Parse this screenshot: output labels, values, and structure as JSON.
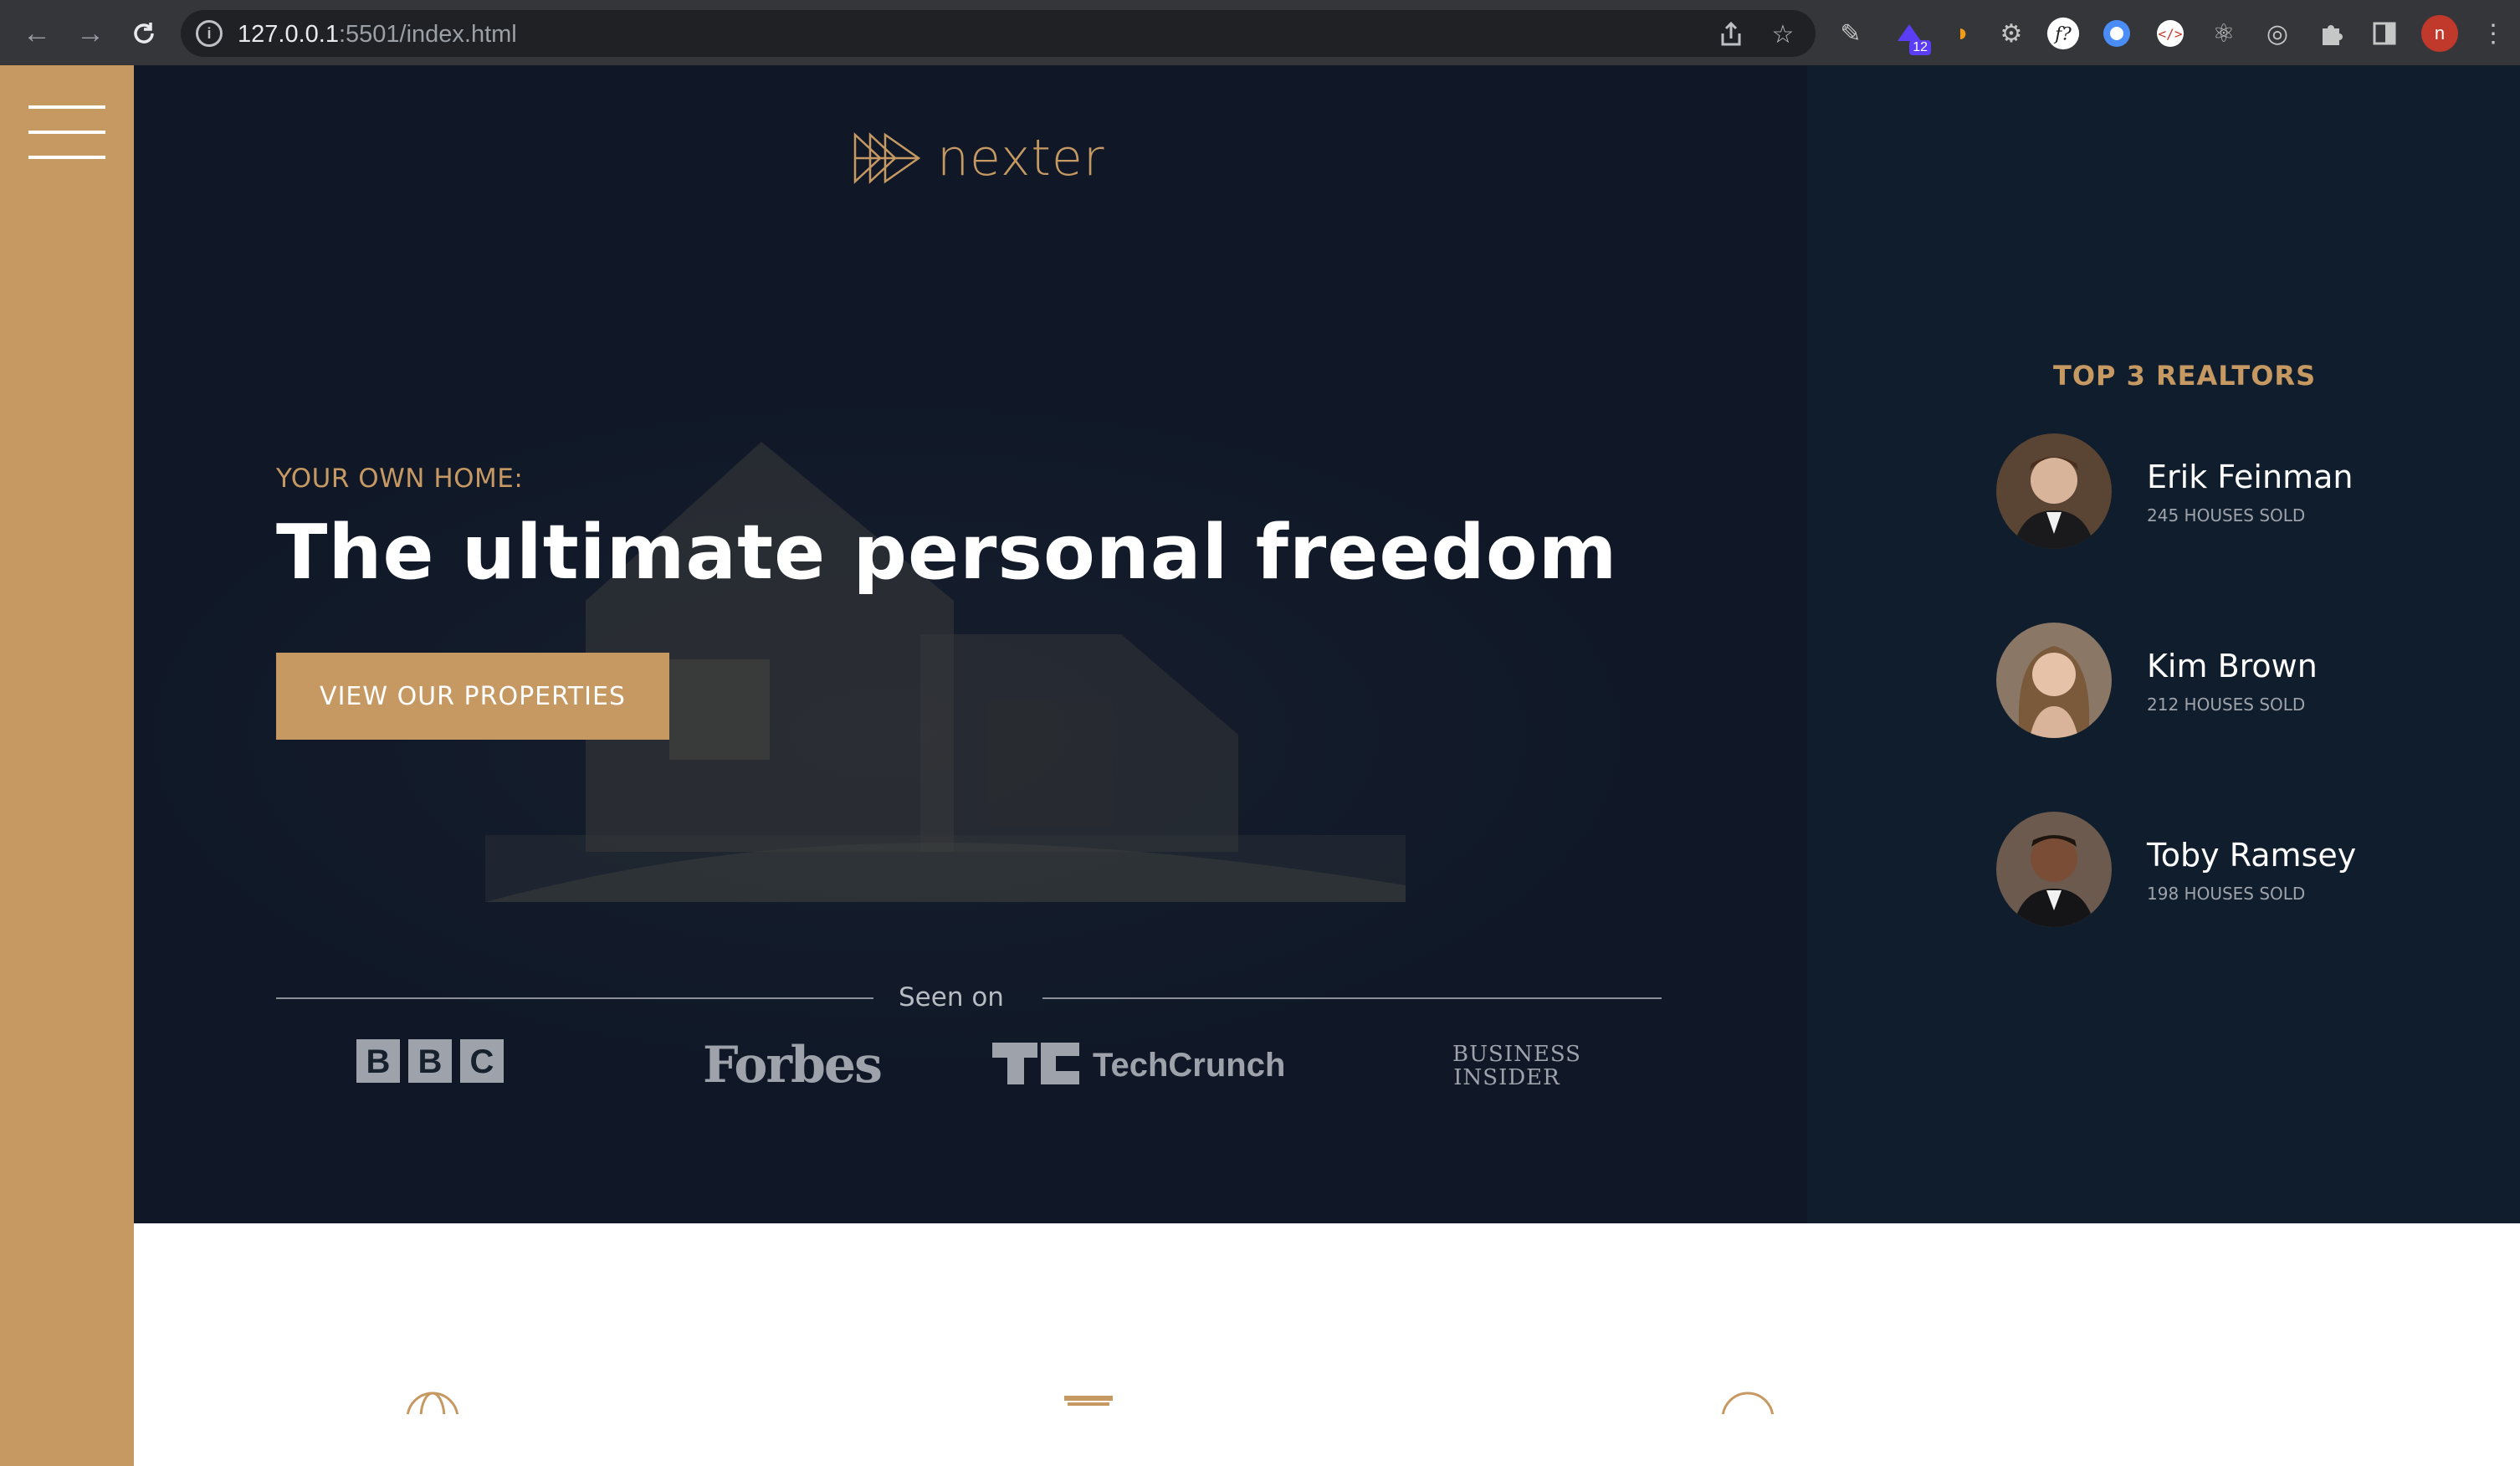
{
  "browser": {
    "url_host": "127.0.0.1",
    "url_rest": ":5501/index.html",
    "extension_badge": "12",
    "profile_initial": "n",
    "icons": [
      "back-icon",
      "forward-icon",
      "reload-icon",
      "info-icon",
      "share-icon",
      "bookmark-star-icon",
      "pen-icon",
      "puzzle-extensions-icon",
      "side-panel-icon",
      "menu-dots-icon"
    ]
  },
  "sidebar": {
    "menu_icon": "hamburger-menu-icon"
  },
  "header": {
    "logo_text": "nexter"
  },
  "hero": {
    "eyebrow": "YOUR OWN HOME:",
    "headline": "The ultimate personal freedom",
    "cta_label": "VIEW OUR PROPERTIES"
  },
  "seen_on": {
    "label": "Seen on",
    "brands": [
      "BBC",
      "Forbes",
      "TechCrunch",
      "BUSINESS INSIDER"
    ]
  },
  "realtors": {
    "title": "TOP 3 REALTORS",
    "items": [
      {
        "name": "Erik Feinman",
        "sold": "245 HOUSES SOLD"
      },
      {
        "name": "Kim Brown",
        "sold": "212 HOUSES SOLD"
      },
      {
        "name": "Toby Ramsey",
        "sold": "198 HOUSES SOLD"
      }
    ]
  },
  "colors": {
    "primary": "#c69963",
    "dark": "#101d2c",
    "chrome": "#35363a"
  }
}
